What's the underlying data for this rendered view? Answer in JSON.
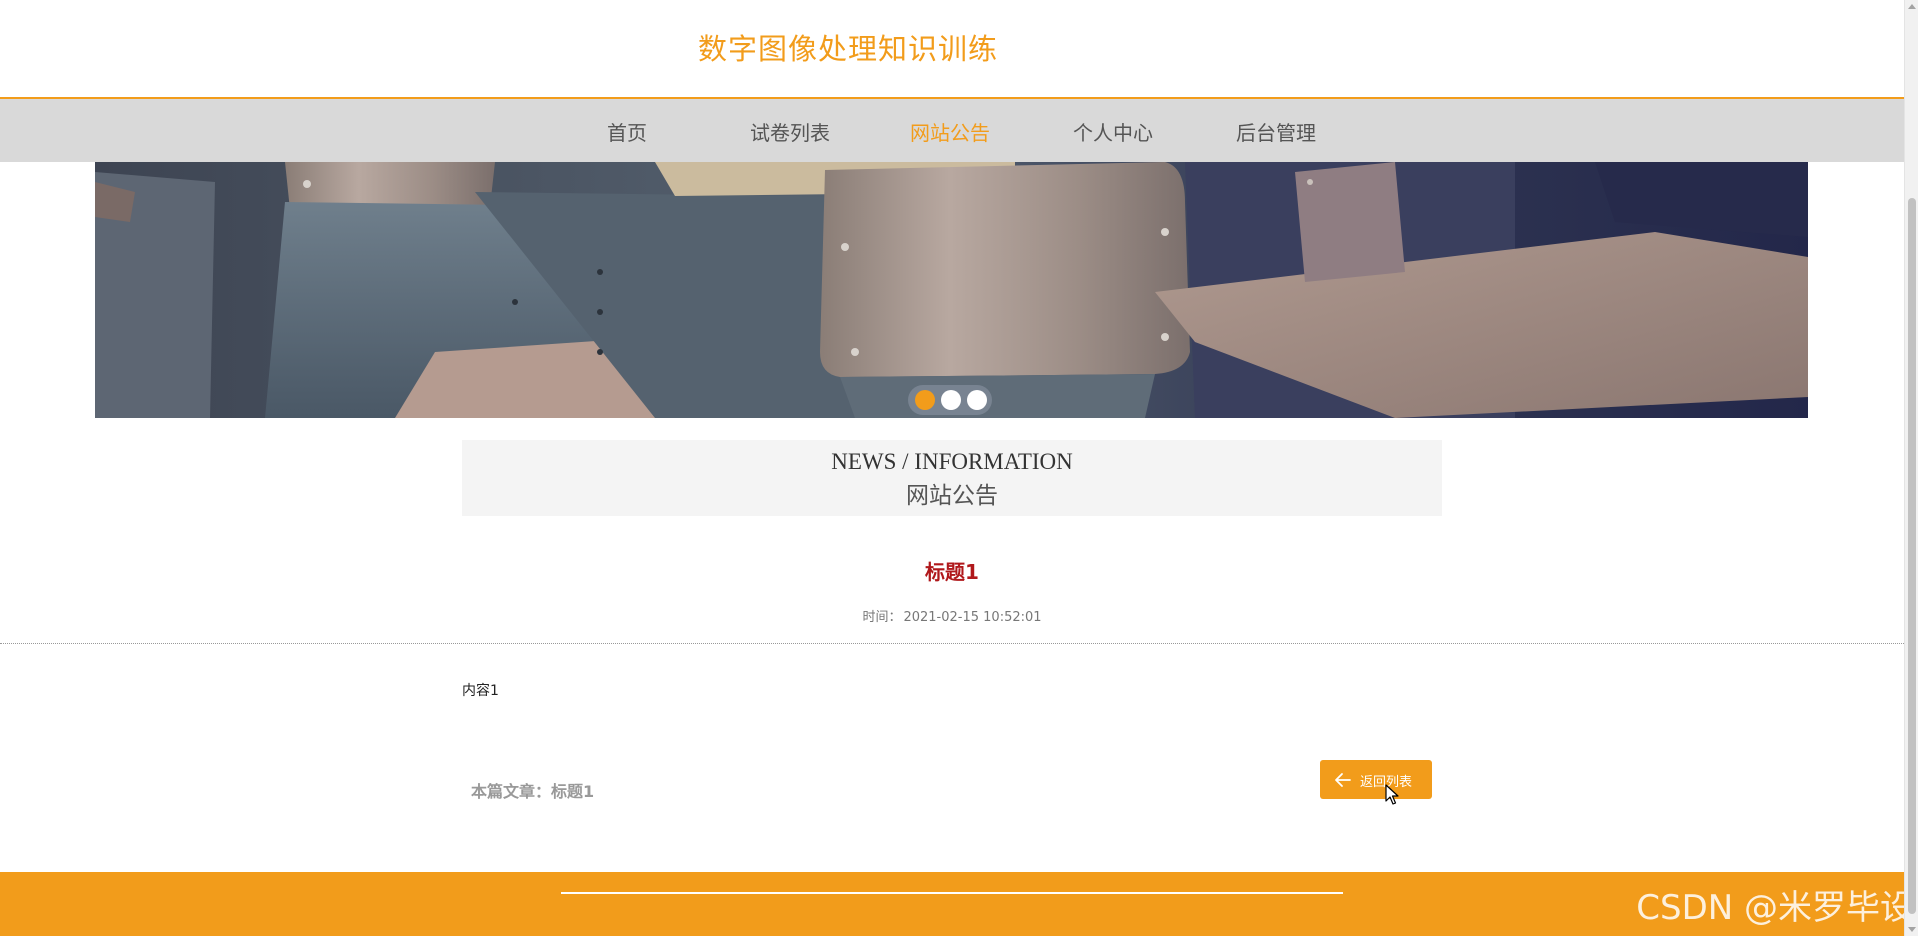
{
  "site": {
    "title": "数字图像处理知识训练"
  },
  "nav": {
    "items": [
      {
        "label": "首页",
        "active": false
      },
      {
        "label": "试卷列表",
        "active": false
      },
      {
        "label": "网站公告",
        "active": true
      },
      {
        "label": "个人中心",
        "active": false
      },
      {
        "label": "后台管理",
        "active": false
      }
    ]
  },
  "banner": {
    "slide_count": 3,
    "active_slide": 1
  },
  "section": {
    "title_en": "NEWS / INFORMATION",
    "title_cn": "网站公告"
  },
  "article": {
    "title": "标题1",
    "time_label": "时间：",
    "time_value": "2021-02-15 10:52:01",
    "content": "内容1",
    "this_article": "本篇文章：标题1",
    "back_label": "返回列表",
    "back_icon": "arrow-left-icon"
  },
  "footer": {
    "watermark": "CSDN @米罗毕设"
  },
  "colors": {
    "accent": "#f29c1b",
    "nav_bg": "#d9d9d9",
    "article_title": "#b0181b"
  }
}
